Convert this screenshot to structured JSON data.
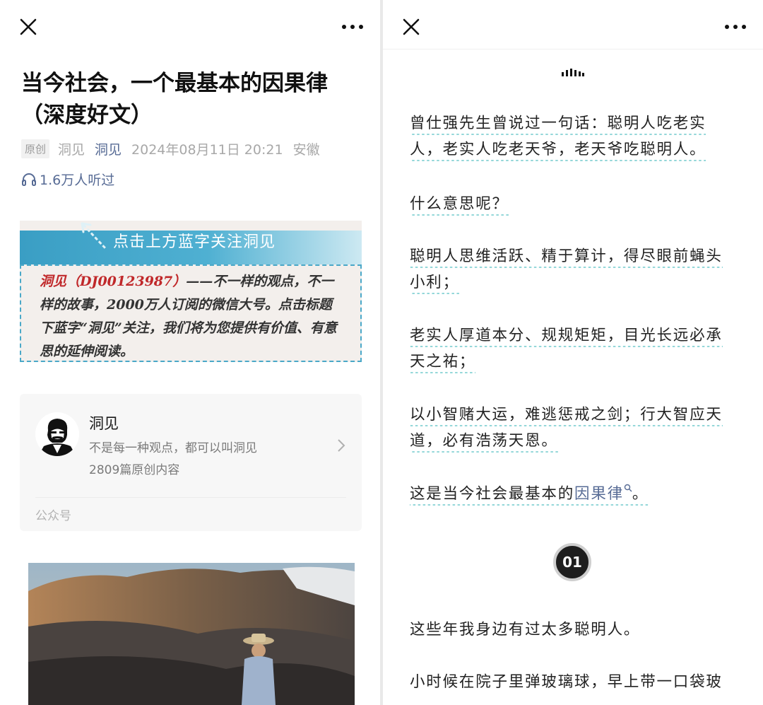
{
  "left": {
    "title": "当今社会，一个最基本的因果律（深度好文）",
    "meta": {
      "tag": "原创",
      "author": "洞见",
      "account": "洞见",
      "date": "2024年08月11日 20:21",
      "location": "安徽"
    },
    "listens": "1.6万人听过",
    "banner": {
      "bar_text": "点击上方蓝字关注洞见",
      "red_text": "洞见（DJ00123987）",
      "body_text": "——不一样的观点，不一样的故事，2000万人订阅的微信大号。点击标题下蓝字“洞见”关注，我们将为您提供有价值、有意思的延伸阅读。"
    },
    "card": {
      "name": "洞见",
      "desc": "不是每一种观点，都可以叫洞见",
      "count": "2809篇原创内容",
      "type": "公众号"
    }
  },
  "right": {
    "p1": "曾仕强先生曾说过一句话：聪明人吃老实人，老实人吃老天爷，老天爷吃聪明人。",
    "p2": "什么意思呢？",
    "p3": "聪明人思维活跃、精于算计，得尽眼前蝇头小利；",
    "p4": "老实人厚道本分、规规矩矩，目光长远必承天之祐；",
    "p5": "以小智赌大运，难逃惩戒之剑；行大智应天道，必有浩荡天恩。",
    "p6_pre": "这是当今社会最基本的",
    "p6_link": "因果律",
    "p6_post": "。",
    "section_num": "01",
    "p7": "这些年我身边有过太多聪明人。",
    "p8": "小时候在院子里弹玻璃球，早上带一口袋玻"
  },
  "colors": {
    "link": "#576b95",
    "dotted_underline": "#94d7d9",
    "banner_blue": "#3a9ec4",
    "red": "#c0282a"
  },
  "icons": [
    "close-icon",
    "more-icon",
    "headphones-icon",
    "chevron-right-icon",
    "audio-wave-icon",
    "search-icon"
  ]
}
